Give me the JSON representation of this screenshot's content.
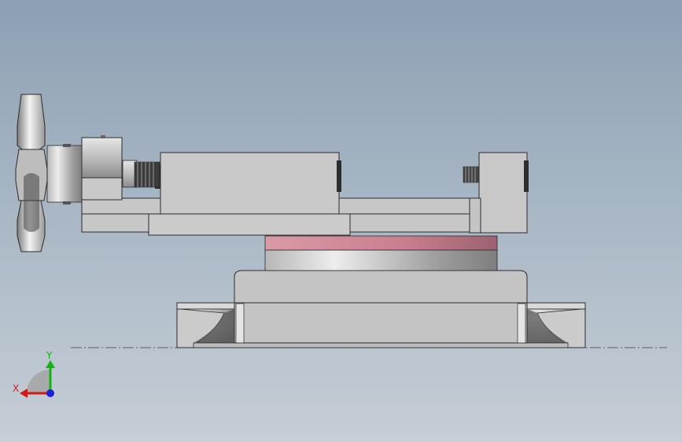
{
  "triad": {
    "x_label": "X",
    "y_label": "Y",
    "x_color": "#d11a1a",
    "y_color": "#13b313",
    "z_color": "#1a22d6"
  },
  "model": {
    "body_color": "#c9c9c9",
    "edge_color": "#2b2b2b",
    "swivel_ring_color": "#cc8090",
    "centerline_color": "#606060"
  }
}
